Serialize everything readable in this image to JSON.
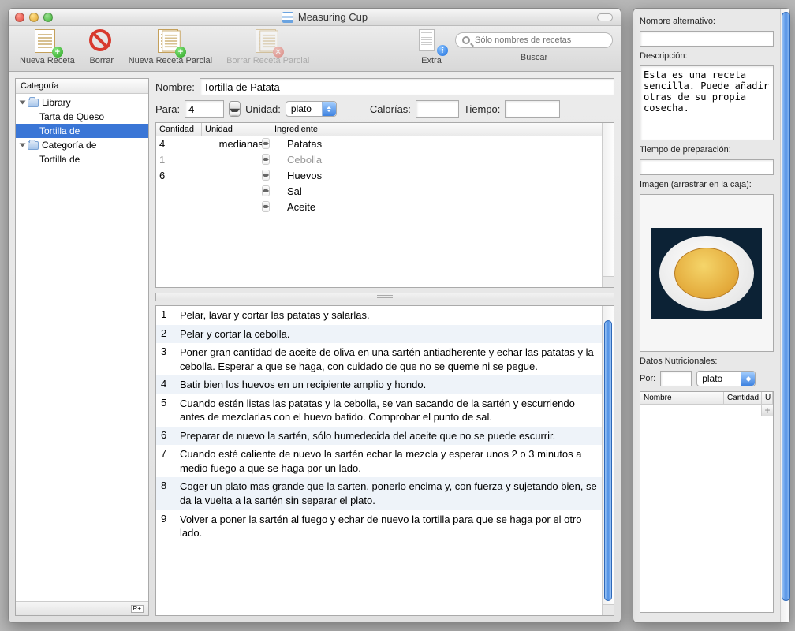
{
  "window": {
    "title": "Measuring Cup"
  },
  "toolbar": {
    "new_recipe": "Nueva Receta",
    "delete": "Borrar",
    "new_partial": "Nueva Receta Parcial",
    "delete_partial": "Borrar Receta Parcial",
    "extra": "Extra",
    "search_placeholder": "Sólo nombres de recetas",
    "search_label": "Buscar"
  },
  "sidebar": {
    "header": "Categoría",
    "items": [
      {
        "label": "Library",
        "type": "folder",
        "expanded": true,
        "depth": 0
      },
      {
        "label": "Tarta de Queso",
        "type": "recipe",
        "depth": 1
      },
      {
        "label": "Tortilla de",
        "type": "recipe",
        "depth": 1,
        "selected": true
      },
      {
        "label": "Categoría de",
        "type": "folder",
        "expanded": true,
        "depth": 0
      },
      {
        "label": "Tortilla de",
        "type": "recipe",
        "depth": 1
      }
    ]
  },
  "recipe": {
    "name_label": "Nombre:",
    "name": "Tortilla de Patata",
    "para_label": "Para:",
    "para_value": "4",
    "unit_label": "Unidad:",
    "unit_value": "plato",
    "calories_label": "Calorías:",
    "calories_value": "",
    "time_label": "Tiempo:",
    "time_value": ""
  },
  "ingredients": {
    "cols": {
      "qty": "Cantidad",
      "unit": "Unidad",
      "ing": "Ingrediente"
    },
    "rows": [
      {
        "qty": "4",
        "unit": "medianas",
        "ing": "Patatas"
      },
      {
        "qty": "1",
        "unit": "",
        "ing": "Cebolla",
        "faded": true
      },
      {
        "qty": "6",
        "unit": "",
        "ing": "Huevos"
      },
      {
        "qty": "",
        "unit": "",
        "ing": "Sal"
      },
      {
        "qty": "",
        "unit": "",
        "ing": "Aceite"
      }
    ]
  },
  "steps": [
    "Pelar, lavar y cortar las patatas y salarlas.",
    "Pelar y cortar la cebolla.",
    "Poner gran cantidad de aceite de oliva en una sartén antiadherente y echar las patatas y la cebolla. Esperar a que se haga, con cuidado de que no se queme ni se pegue.",
    "Batir bien los huevos en un recipiente amplio y hondo.",
    "Cuando estén listas las patatas y la cebolla, se van sacando de la sartén y escurriendo antes de mezclarlas con el huevo batido. Comprobar el punto de sal.",
    "Preparar de nuevo la sartén, sólo humedecida del aceite que no se puede escurrir.",
    "Cuando esté caliente de nuevo la sartén echar la mezcla y esperar unos 2 o 3 minutos a medio fuego a que se haga por un lado.",
    "Coger un plato mas grande que la sarten, ponerlo encima y, con fuerza y sujetando bien, se da la vuelta a la sartén sin separar el plato.",
    "Volver a poner la sartén al fuego y echar de nuevo la tortilla para que se haga por el otro lado."
  ],
  "extra": {
    "alt_name_label": "Nombre alternativo:",
    "alt_name": "",
    "desc_label": "Descripción:",
    "desc": "Esta es una receta sencilla. Puede añadir otras de su propia cosecha.",
    "prep_label": "Tiempo de preparación:",
    "prep": "",
    "image_label": "Imagen (arrastrar en la caja):",
    "nut_header": "Datos Nutricionales:",
    "por_label": "Por:",
    "por_value": "",
    "por_unit": "plato",
    "nut_cols": {
      "name": "Nombre",
      "qty": "Cantidad",
      "u": "U"
    }
  }
}
